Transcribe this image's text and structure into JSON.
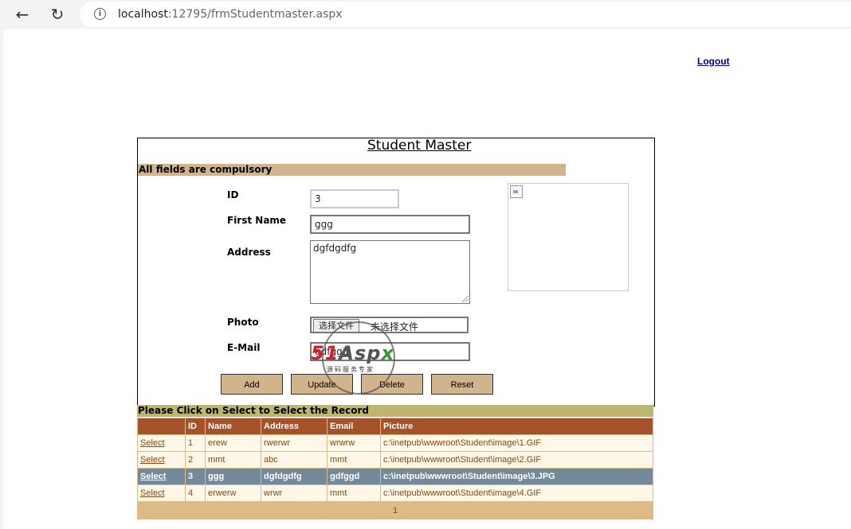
{
  "browser": {
    "url_host": "localhost",
    "url_rest": ":12795/frmStudentmaster.aspx"
  },
  "header": {
    "logout_label": "Logout"
  },
  "form": {
    "title": "Student Master",
    "notice": "All fields are compulsory",
    "labels": {
      "id": "ID",
      "first_name": "First Name",
      "address": "Address",
      "photo": "Photo",
      "email": "E-Mail"
    },
    "values": {
      "id": "3",
      "first_name": "ggg",
      "address": "dgfdgdfg",
      "email": "gdfggd"
    },
    "file_button": "选择文件",
    "file_status": "未选择文件",
    "buttons": {
      "add": "Add",
      "update": "Update",
      "delete": "Delete",
      "reset": "Reset"
    }
  },
  "watermark": {
    "logo_part1": "51",
    "logo_part2": "Asp",
    "logo_part3": "x",
    "subtitle": "源码服务专家"
  },
  "grid": {
    "caption": "Please Click on Select to Select the Record",
    "columns": [
      "",
      "ID",
      "Name",
      "Address",
      "Email",
      "Picture"
    ],
    "select_label": "Select",
    "rows": [
      {
        "id": "1",
        "name": "erew",
        "address": "rwerwr",
        "email": "wrwrw",
        "picture": "c:\\inetpub\\wwwroot\\Student\\image\\1.GIF"
      },
      {
        "id": "2",
        "name": "mmt",
        "address": "abc",
        "email": "mmt",
        "picture": "c:\\inetpub\\wwwroot\\Student\\image\\2.GIF"
      },
      {
        "id": "3",
        "name": "ggg",
        "address": "dgfdgdfg",
        "email": "gdfggd",
        "picture": "c:\\inetpub\\wwwroot\\Student\\image\\3.JPG"
      },
      {
        "id": "4",
        "name": "erwerw",
        "address": "wrwr",
        "email": "mmt",
        "picture": "c:\\inetpub\\wwwroot\\Student\\image\\4.GIF"
      }
    ],
    "selected_row": 2,
    "pager": "1"
  },
  "colors": {
    "tan": "#d2b48c",
    "header_brown": "#a55129",
    "selected_row": "#738a9c",
    "caption_khaki": "#bdb76b"
  }
}
